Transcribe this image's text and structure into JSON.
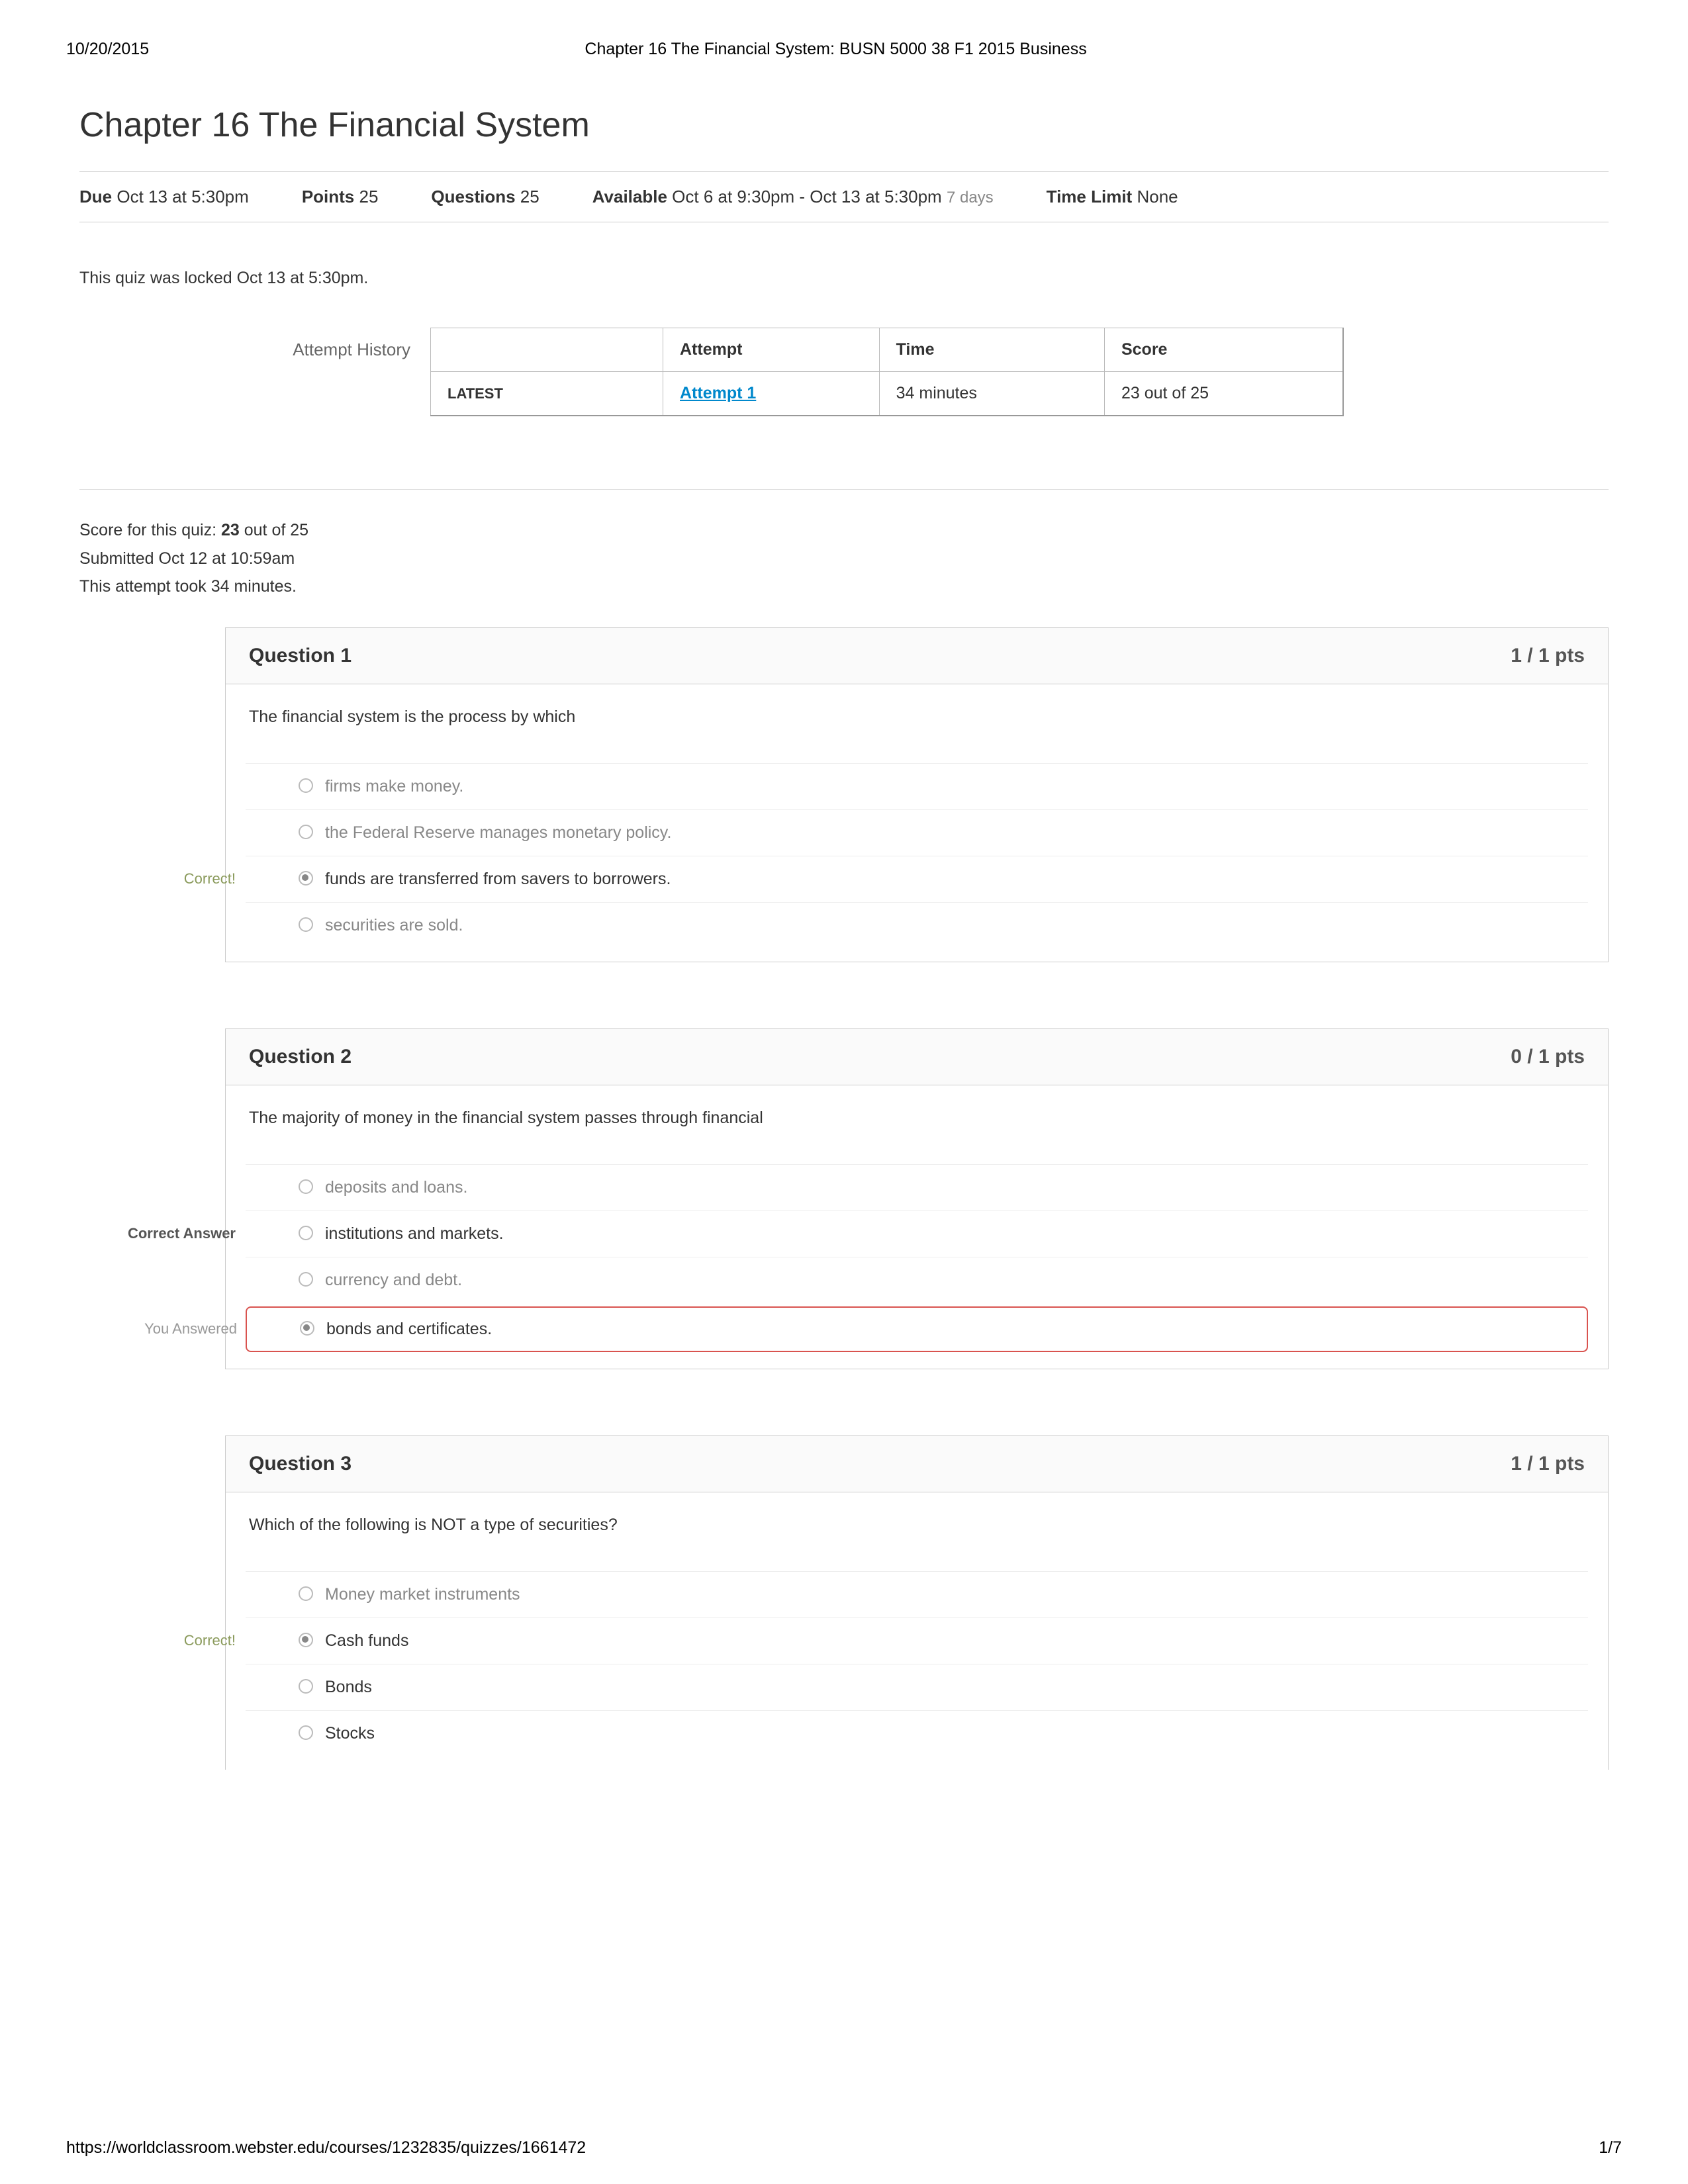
{
  "print_header": {
    "date": "10/20/2015",
    "title": "Chapter 16 The Financial System: BUSN 5000 38 F1 2015 Business"
  },
  "quiz_title": "Chapter 16 The Financial System",
  "meta": {
    "due_label": "Due",
    "due_value": "Oct 13 at 5:30pm",
    "points_label": "Points",
    "points_value": "25",
    "questions_label": "Questions",
    "questions_value": "25",
    "available_label": "Available",
    "available_value": "Oct 6 at 9:30pm - Oct 13 at 5:30pm",
    "available_days": "7 days",
    "time_limit_label": "Time Limit",
    "time_limit_value": "None"
  },
  "locked_msg": "This quiz was locked Oct 13 at 5:30pm.",
  "attempt_history_label": "Attempt History",
  "attempt_table": {
    "h_attempt": "Attempt",
    "h_time": "Time",
    "h_score": "Score",
    "latest_label": "LATEST",
    "attempt_link": "Attempt 1",
    "time": "34 minutes",
    "score": "23 out of 25"
  },
  "score_block": {
    "line1a": "Score for this quiz: ",
    "line1b": "23",
    "line1c": " out of 25",
    "line2": "Submitted Oct 12 at 10:59am",
    "line3": "This attempt took 34 minutes."
  },
  "labels": {
    "correct": "Correct!",
    "correct_answer": "Correct Answer",
    "you_answered": "You Answered"
  },
  "q1": {
    "title": "Question 1",
    "pts": "1 / 1 pts",
    "text": "The financial system is the process by which",
    "a1": "firms make money.",
    "a2": "the Federal Reserve manages monetary policy.",
    "a3": "funds are transferred from savers to borrowers.",
    "a4": "securities are sold."
  },
  "q2": {
    "title": "Question 2",
    "pts": "0 / 1 pts",
    "text": "The majority of money in the financial system passes through financial",
    "a1": "deposits and loans.",
    "a2": "institutions and markets.",
    "a3": "currency and debt.",
    "a4": "bonds and certificates."
  },
  "q3": {
    "title": "Question 3",
    "pts": "1 / 1 pts",
    "text": "Which of the following is NOT a type of securities?",
    "a1": "Money market instruments",
    "a2": "Cash funds",
    "a3": "Bonds",
    "a4": "Stocks"
  },
  "footer": {
    "url": "https://worldclassroom.webster.edu/courses/1232835/quizzes/1661472",
    "page": "1/7"
  }
}
